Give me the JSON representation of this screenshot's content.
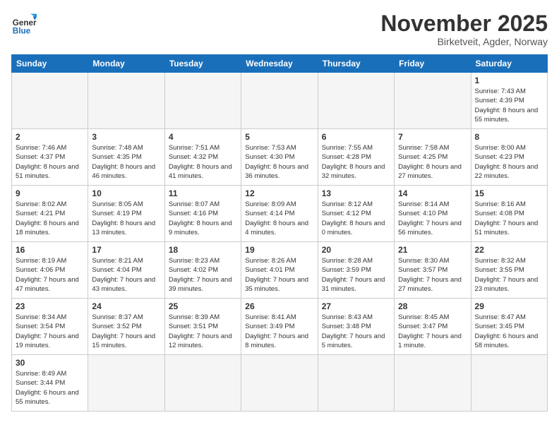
{
  "logo": {
    "text_general": "General",
    "text_blue": "Blue"
  },
  "title": "November 2025",
  "location": "Birketveit, Agder, Norway",
  "weekdays": [
    "Sunday",
    "Monday",
    "Tuesday",
    "Wednesday",
    "Thursday",
    "Friday",
    "Saturday"
  ],
  "weeks": [
    [
      {
        "day": "",
        "info": ""
      },
      {
        "day": "",
        "info": ""
      },
      {
        "day": "",
        "info": ""
      },
      {
        "day": "",
        "info": ""
      },
      {
        "day": "",
        "info": ""
      },
      {
        "day": "",
        "info": ""
      },
      {
        "day": "1",
        "info": "Sunrise: 7:43 AM\nSunset: 4:39 PM\nDaylight: 8 hours\nand 55 minutes."
      }
    ],
    [
      {
        "day": "2",
        "info": "Sunrise: 7:46 AM\nSunset: 4:37 PM\nDaylight: 8 hours\nand 51 minutes."
      },
      {
        "day": "3",
        "info": "Sunrise: 7:48 AM\nSunset: 4:35 PM\nDaylight: 8 hours\nand 46 minutes."
      },
      {
        "day": "4",
        "info": "Sunrise: 7:51 AM\nSunset: 4:32 PM\nDaylight: 8 hours\nand 41 minutes."
      },
      {
        "day": "5",
        "info": "Sunrise: 7:53 AM\nSunset: 4:30 PM\nDaylight: 8 hours\nand 36 minutes."
      },
      {
        "day": "6",
        "info": "Sunrise: 7:55 AM\nSunset: 4:28 PM\nDaylight: 8 hours\nand 32 minutes."
      },
      {
        "day": "7",
        "info": "Sunrise: 7:58 AM\nSunset: 4:25 PM\nDaylight: 8 hours\nand 27 minutes."
      },
      {
        "day": "8",
        "info": "Sunrise: 8:00 AM\nSunset: 4:23 PM\nDaylight: 8 hours\nand 22 minutes."
      }
    ],
    [
      {
        "day": "9",
        "info": "Sunrise: 8:02 AM\nSunset: 4:21 PM\nDaylight: 8 hours\nand 18 minutes."
      },
      {
        "day": "10",
        "info": "Sunrise: 8:05 AM\nSunset: 4:19 PM\nDaylight: 8 hours\nand 13 minutes."
      },
      {
        "day": "11",
        "info": "Sunrise: 8:07 AM\nSunset: 4:16 PM\nDaylight: 8 hours\nand 9 minutes."
      },
      {
        "day": "12",
        "info": "Sunrise: 8:09 AM\nSunset: 4:14 PM\nDaylight: 8 hours\nand 4 minutes."
      },
      {
        "day": "13",
        "info": "Sunrise: 8:12 AM\nSunset: 4:12 PM\nDaylight: 8 hours\nand 0 minutes."
      },
      {
        "day": "14",
        "info": "Sunrise: 8:14 AM\nSunset: 4:10 PM\nDaylight: 7 hours\nand 56 minutes."
      },
      {
        "day": "15",
        "info": "Sunrise: 8:16 AM\nSunset: 4:08 PM\nDaylight: 7 hours\nand 51 minutes."
      }
    ],
    [
      {
        "day": "16",
        "info": "Sunrise: 8:19 AM\nSunset: 4:06 PM\nDaylight: 7 hours\nand 47 minutes."
      },
      {
        "day": "17",
        "info": "Sunrise: 8:21 AM\nSunset: 4:04 PM\nDaylight: 7 hours\nand 43 minutes."
      },
      {
        "day": "18",
        "info": "Sunrise: 8:23 AM\nSunset: 4:02 PM\nDaylight: 7 hours\nand 39 minutes."
      },
      {
        "day": "19",
        "info": "Sunrise: 8:26 AM\nSunset: 4:01 PM\nDaylight: 7 hours\nand 35 minutes."
      },
      {
        "day": "20",
        "info": "Sunrise: 8:28 AM\nSunset: 3:59 PM\nDaylight: 7 hours\nand 31 minutes."
      },
      {
        "day": "21",
        "info": "Sunrise: 8:30 AM\nSunset: 3:57 PM\nDaylight: 7 hours\nand 27 minutes."
      },
      {
        "day": "22",
        "info": "Sunrise: 8:32 AM\nSunset: 3:55 PM\nDaylight: 7 hours\nand 23 minutes."
      }
    ],
    [
      {
        "day": "23",
        "info": "Sunrise: 8:34 AM\nSunset: 3:54 PM\nDaylight: 7 hours\nand 19 minutes."
      },
      {
        "day": "24",
        "info": "Sunrise: 8:37 AM\nSunset: 3:52 PM\nDaylight: 7 hours\nand 15 minutes."
      },
      {
        "day": "25",
        "info": "Sunrise: 8:39 AM\nSunset: 3:51 PM\nDaylight: 7 hours\nand 12 minutes."
      },
      {
        "day": "26",
        "info": "Sunrise: 8:41 AM\nSunset: 3:49 PM\nDaylight: 7 hours\nand 8 minutes."
      },
      {
        "day": "27",
        "info": "Sunrise: 8:43 AM\nSunset: 3:48 PM\nDaylight: 7 hours\nand 5 minutes."
      },
      {
        "day": "28",
        "info": "Sunrise: 8:45 AM\nSunset: 3:47 PM\nDaylight: 7 hours\nand 1 minute."
      },
      {
        "day": "29",
        "info": "Sunrise: 8:47 AM\nSunset: 3:45 PM\nDaylight: 6 hours\nand 58 minutes."
      }
    ],
    [
      {
        "day": "30",
        "info": "Sunrise: 8:49 AM\nSunset: 3:44 PM\nDaylight: 6 hours\nand 55 minutes."
      },
      {
        "day": "",
        "info": ""
      },
      {
        "day": "",
        "info": ""
      },
      {
        "day": "",
        "info": ""
      },
      {
        "day": "",
        "info": ""
      },
      {
        "day": "",
        "info": ""
      },
      {
        "day": "",
        "info": ""
      }
    ]
  ]
}
